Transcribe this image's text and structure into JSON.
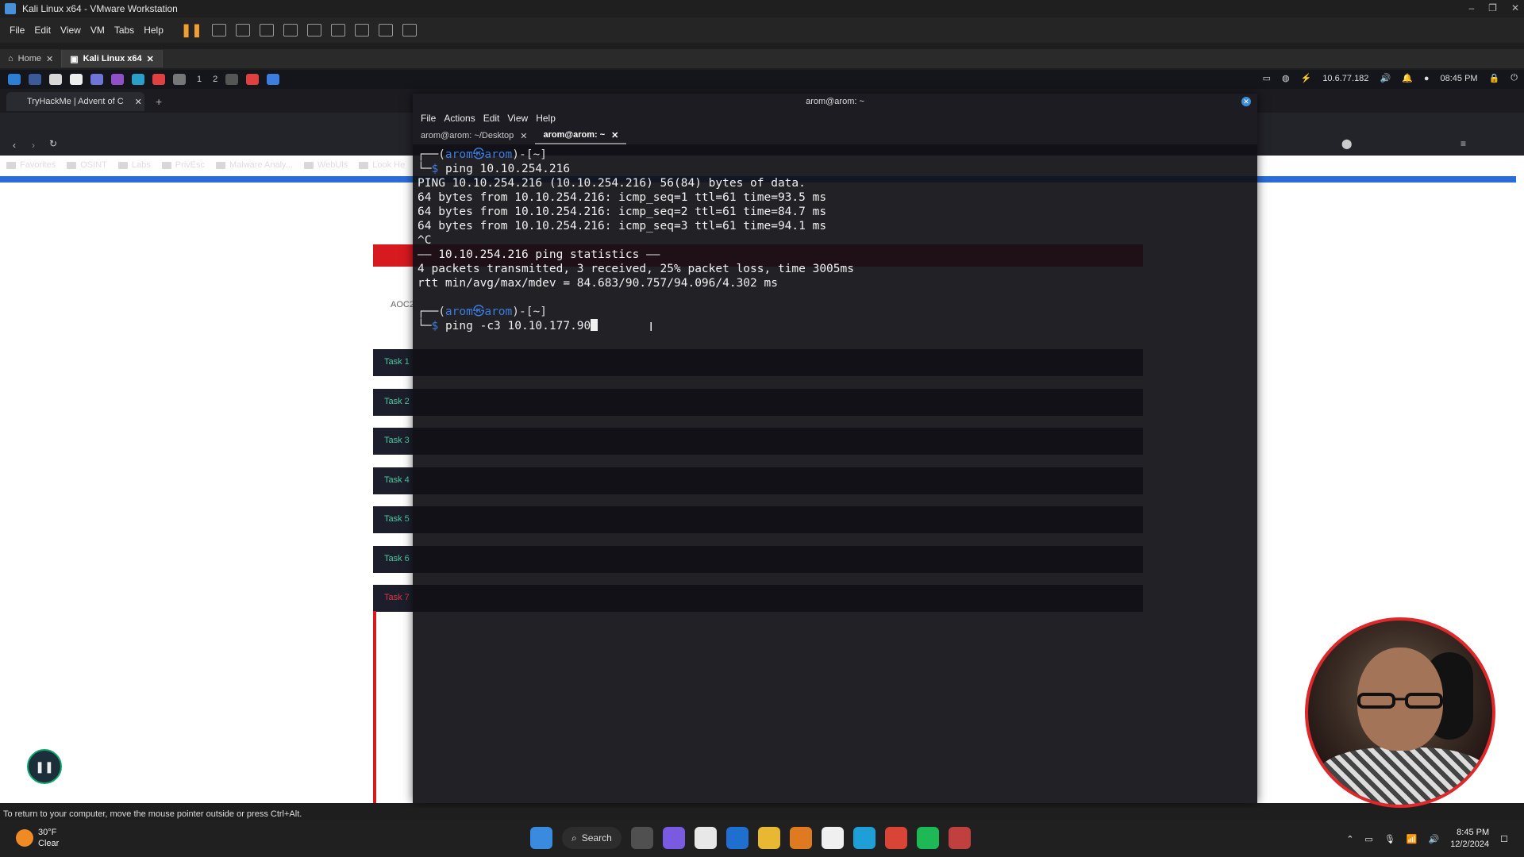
{
  "vmware": {
    "title": "Kali Linux x64 - VMware Workstation",
    "menu": [
      "File",
      "Edit",
      "View",
      "VM",
      "Tabs",
      "Help"
    ],
    "tabs": [
      {
        "label": "Home"
      },
      {
        "label": "Kali Linux x64"
      }
    ],
    "status_message": "To return to your computer, move the mouse pointer outside or press Ctrl+Alt."
  },
  "kali_panel": {
    "workspaces": [
      "1",
      "2"
    ],
    "ip": "10.6.77.182",
    "time": "08:45 PM"
  },
  "browser": {
    "tab_title": "TryHackMe | Advent of C",
    "bookmarks": [
      "Favorites",
      "OSINT",
      "Labs",
      "PrivEsc",
      "Malware Analy...",
      "WebUls",
      "Look He"
    ],
    "page": {
      "partial_label": "AOC2",
      "tasks": [
        "Task 1",
        "Task 2",
        "Task 3",
        "Task 4",
        "Task 5",
        "Task 6",
        "Task 7"
      ]
    }
  },
  "terminal": {
    "window_title": "arom@arom: ~",
    "menu": [
      "File",
      "Actions",
      "Edit",
      "View",
      "Help"
    ],
    "tabs": [
      "arom@arom: ~/Desktop",
      "arom@arom: ~"
    ],
    "prompt_user": "arom㉿arom",
    "prompt_dir": "~",
    "cmd1": "ping 10.10.254.216",
    "output": [
      "PING 10.10.254.216 (10.10.254.216) 56(84) bytes of data.",
      "64 bytes from 10.10.254.216: icmp_seq=1 ttl=61 time=93.5 ms",
      "64 bytes from 10.10.254.216: icmp_seq=2 ttl=61 time=84.7 ms",
      "64 bytes from 10.10.254.216: icmp_seq=3 ttl=61 time=94.1 ms",
      "^C",
      "—— 10.10.254.216 ping statistics ——",
      "4 packets transmitted, 3 received, 25% packet loss, time 3005ms",
      "rtt min/avg/max/mdev = 84.683/90.757/94.096/4.302 ms"
    ],
    "cmd2": "ping -c3 10.10.177.90"
  },
  "taskbar": {
    "weather_temp": "30°F",
    "weather_desc": "Clear",
    "search_label": "Search",
    "time": "8:45 PM",
    "date": "12/2/2024"
  }
}
